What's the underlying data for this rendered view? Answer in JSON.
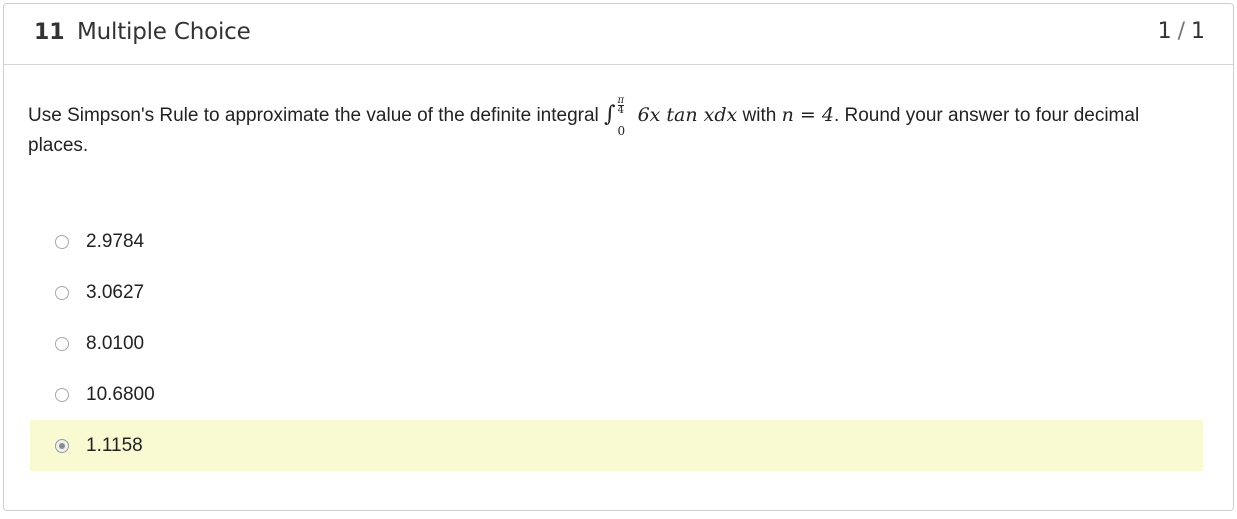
{
  "question": {
    "number": "11",
    "type": "Multiple Choice",
    "score": {
      "earned": "1",
      "separator": "/",
      "total": "1"
    },
    "prompt": {
      "before": "Use Simpson's Rule to approximate the value of the definite integral ",
      "integral_upper_num": "π",
      "integral_upper_den": "4",
      "integral_lower": "0",
      "integrand": "6x tan xdx",
      "middle": " with ",
      "condition": "n = 4",
      "after": ". Round your answer to four decimal places."
    },
    "options": [
      {
        "label": "2.9784",
        "selected": false
      },
      {
        "label": "3.0627",
        "selected": false
      },
      {
        "label": "8.0100",
        "selected": false
      },
      {
        "label": "10.6800",
        "selected": false
      },
      {
        "label": "1.1158",
        "selected": true
      }
    ],
    "colors": {
      "selected_highlight": "#fafad2",
      "border": "#cfcfcf"
    }
  }
}
